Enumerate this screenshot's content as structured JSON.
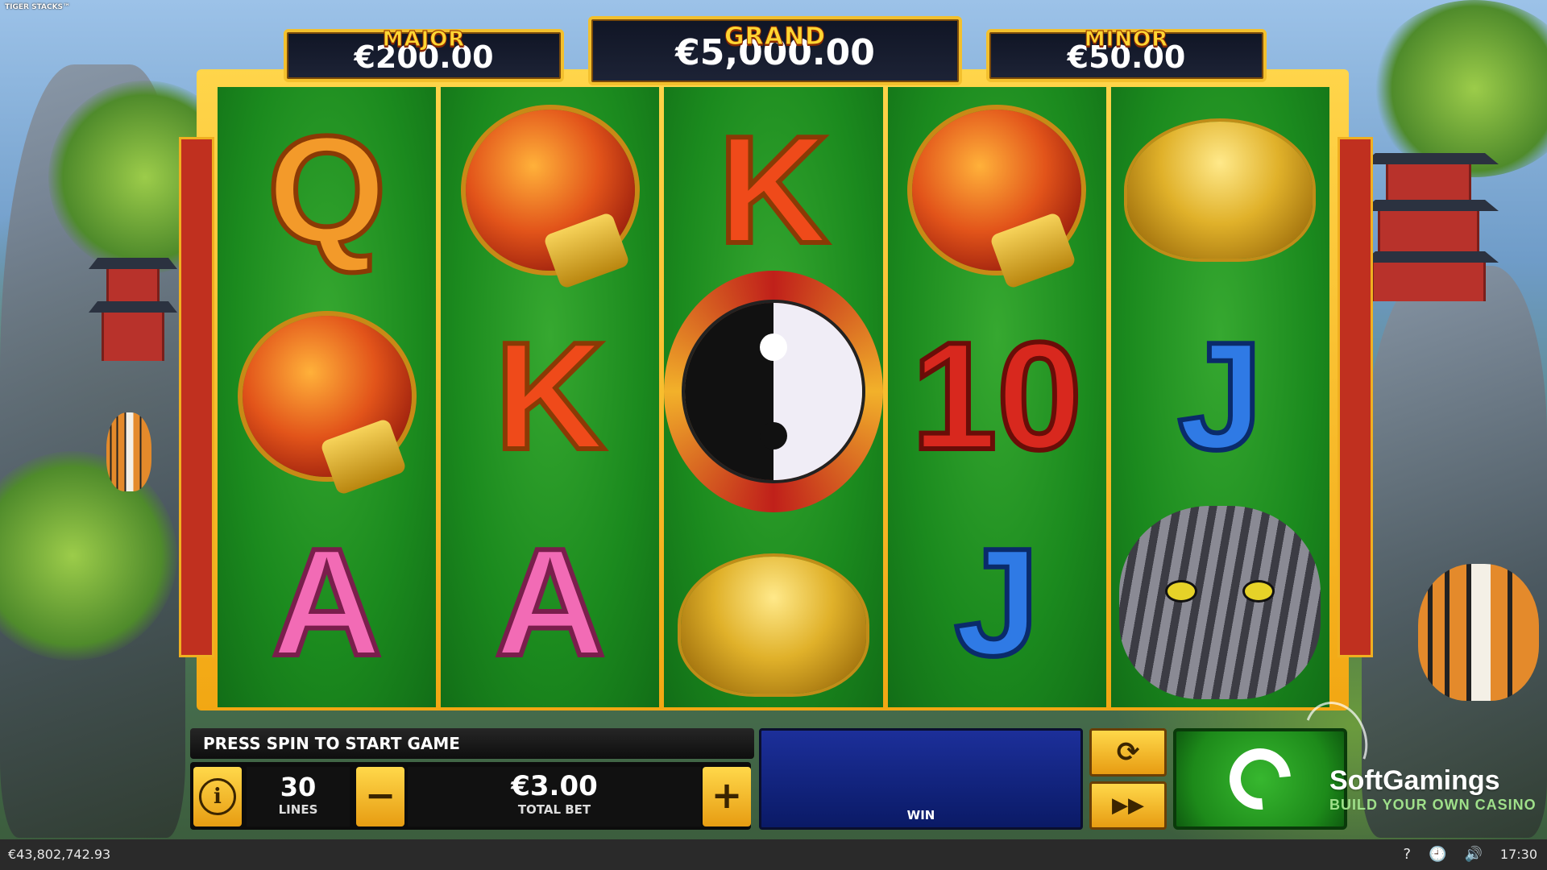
{
  "game_title": "TIGER STACKS™",
  "jackpots": {
    "major": {
      "label": "MAJOR",
      "value": "€200.00"
    },
    "grand": {
      "label": "GRAND",
      "value": "€5,000.00"
    },
    "minor": {
      "label": "MINOR",
      "value": "€50.00"
    }
  },
  "reels": [
    [
      "Q",
      "lantern",
      "A"
    ],
    [
      "lantern",
      "K",
      "A"
    ],
    [
      "K",
      "yin-yang",
      "gold-ingot"
    ],
    [
      "lantern",
      "10",
      "J"
    ],
    [
      "gold-ingot",
      "J",
      "tiger"
    ]
  ],
  "symbol_text": {
    "q": "Q",
    "k": "K",
    "a": "A",
    "ten": "10",
    "j": "J"
  },
  "status_message": "PRESS SPIN TO START GAME",
  "lines": {
    "value": "30",
    "label": "LINES"
  },
  "bet": {
    "value": "€3.00",
    "label": "TOTAL BET",
    "minus": "−",
    "plus": "+"
  },
  "win": {
    "label": "WIN"
  },
  "buttons": {
    "info": "i",
    "autoplay": "⟳",
    "turbo": "▶▶"
  },
  "branding": {
    "name": "SoftGamings",
    "tagline": "BUILD YOUR OWN CASINO"
  },
  "footer": {
    "balance": "€43,802,742.93",
    "help": "?",
    "history": "🕘",
    "sound": "🔊",
    "time": "17:30"
  },
  "icons": {
    "info": "info-icon",
    "spin": "spin-icon",
    "autoplay": "autoplay-icon",
    "turbo": "fast-forward-icon",
    "help": "help-icon",
    "history": "history-icon",
    "sound": "speaker-icon"
  }
}
